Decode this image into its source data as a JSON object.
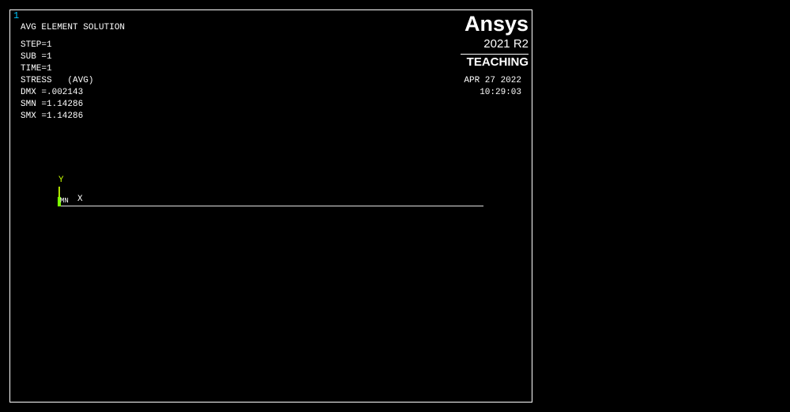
{
  "window": {
    "number": "1",
    "number_color": "#00c8ff"
  },
  "solution": {
    "title": "AVG ELEMENT SOLUTION",
    "step": "STEP=1",
    "sub": "SUB =1",
    "time": "TIME=1",
    "stress": "STRESS   (AVG)",
    "dmx": "DMX =.002143",
    "smn": "SMN =1.14286",
    "smx": "SMX =1.14286"
  },
  "logo": {
    "name": "Ansys",
    "version": "2021 R2",
    "edition": "TEACHING"
  },
  "datetime": {
    "date": "APR 27 2022",
    "time": "10:29:03"
  },
  "triad": {
    "y_label": "Y",
    "x_label": "X",
    "mn_label": "MN",
    "y_color": "#c8ff00",
    "x_color": "#ffffff",
    "marker_color": "#7cff00"
  },
  "colors": {
    "background": "#000000",
    "text": "#ffffff",
    "border": "#ffffff"
  }
}
